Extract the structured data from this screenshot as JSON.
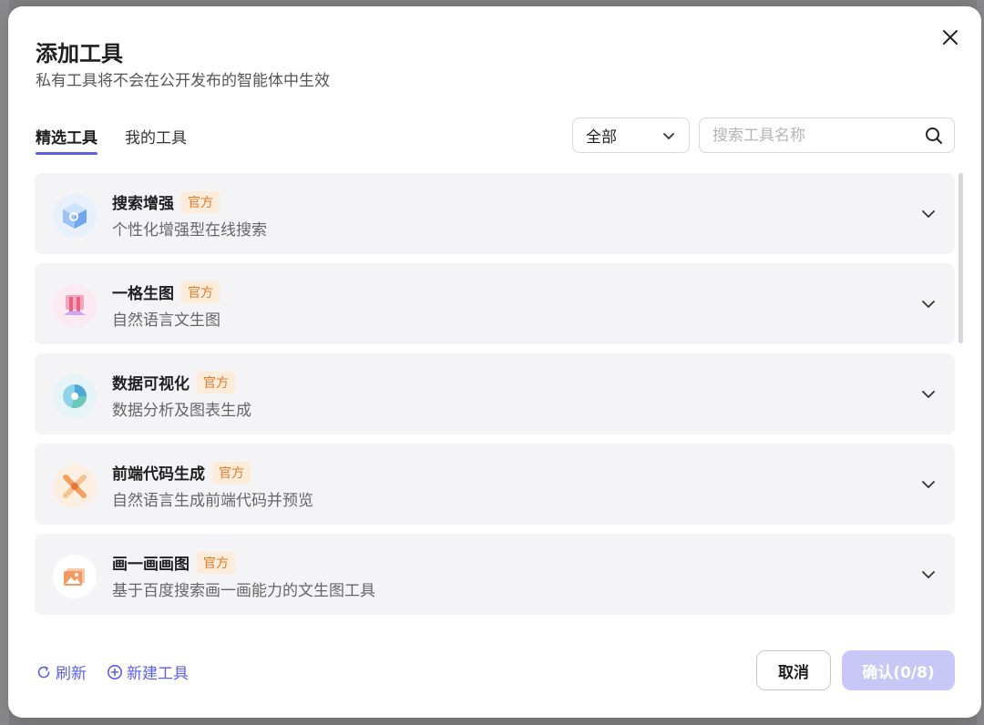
{
  "dialog": {
    "title": "添加工具",
    "subtitle": "私有工具将不会在公开发布的智能体中生效"
  },
  "tabs": [
    {
      "label": "精选工具",
      "active": true
    },
    {
      "label": "我的工具",
      "active": false
    }
  ],
  "filter": {
    "selected": "全部"
  },
  "search": {
    "placeholder": "搜索工具名称",
    "value": ""
  },
  "tools": [
    {
      "name": "搜索增强",
      "badge": "官方",
      "desc": "个性化增强型在线搜索",
      "icon": "cube-search-icon"
    },
    {
      "name": "一格生图",
      "badge": "官方",
      "desc": "自然语言文生图",
      "icon": "image-gen-icon"
    },
    {
      "name": "数据可视化",
      "badge": "官方",
      "desc": "数据分析及图表生成",
      "icon": "data-viz-icon"
    },
    {
      "name": "前端代码生成",
      "badge": "官方",
      "desc": "自然语言生成前端代码并预览",
      "icon": "code-gen-icon"
    },
    {
      "name": "画一画画图",
      "badge": "官方",
      "desc": "基于百度搜索画一画能力的文生图工具",
      "icon": "picture-icon"
    }
  ],
  "footer": {
    "refresh_label": "刷新",
    "new_tool_label": "新建工具",
    "cancel_label": "取消",
    "confirm_label": "确认(0/8)"
  },
  "colors": {
    "accent": "#5b5fe8",
    "badge_text": "#e07a2a",
    "badge_bg": "#fdecd9",
    "confirm_disabled": "#c7c8f6"
  }
}
